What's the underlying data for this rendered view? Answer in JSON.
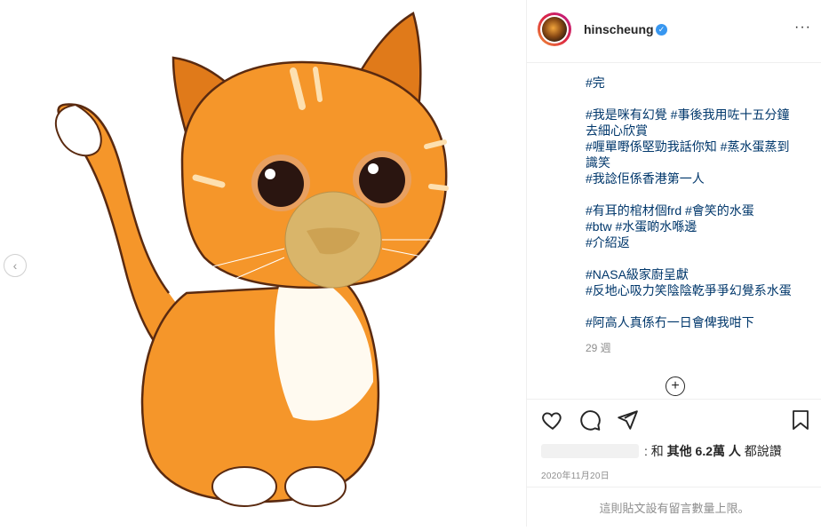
{
  "post": {
    "username": "hinscheung",
    "verified_icon": "verified-badge-icon",
    "more_label": "···",
    "caption_lines": [
      "#完",
      "",
      "#我是咪有幻覺 #事後我用咗十五分鐘",
      "去細心欣賞",
      "#喱單嘢係堅勁我話你知 #蒸水蛋蒸到",
      "識笑",
      "#我諗佢係香港第一人",
      "",
      "#有耳的棺材個frd #會笑的水蛋",
      "#btw #水蛋啲水喺邊",
      "#介紹返",
      "",
      "#NASA級家廚呈獻",
      "#反地心吸力笑陰陰乾爭爭幻覺系水蛋",
      "",
      "#阿高人真係冇一日會俾我咁下"
    ],
    "time_ago": "29 週",
    "load_more_icon": "plus-circle-icon",
    "likes_prefix": ": 和 ",
    "likes_strong": "其他 6.2萬 人",
    "likes_suffix": " 都說讚",
    "date": "2020年11月20日",
    "footer_note": "這則貼文設有留言數量上限。"
  },
  "colors": {
    "accent": "#3897f0",
    "link": "#00376b",
    "muted": "#8e8e8e"
  },
  "icons": [
    "heart-icon",
    "comment-icon",
    "share-icon",
    "bookmark-icon",
    "chevron-left-icon"
  ]
}
